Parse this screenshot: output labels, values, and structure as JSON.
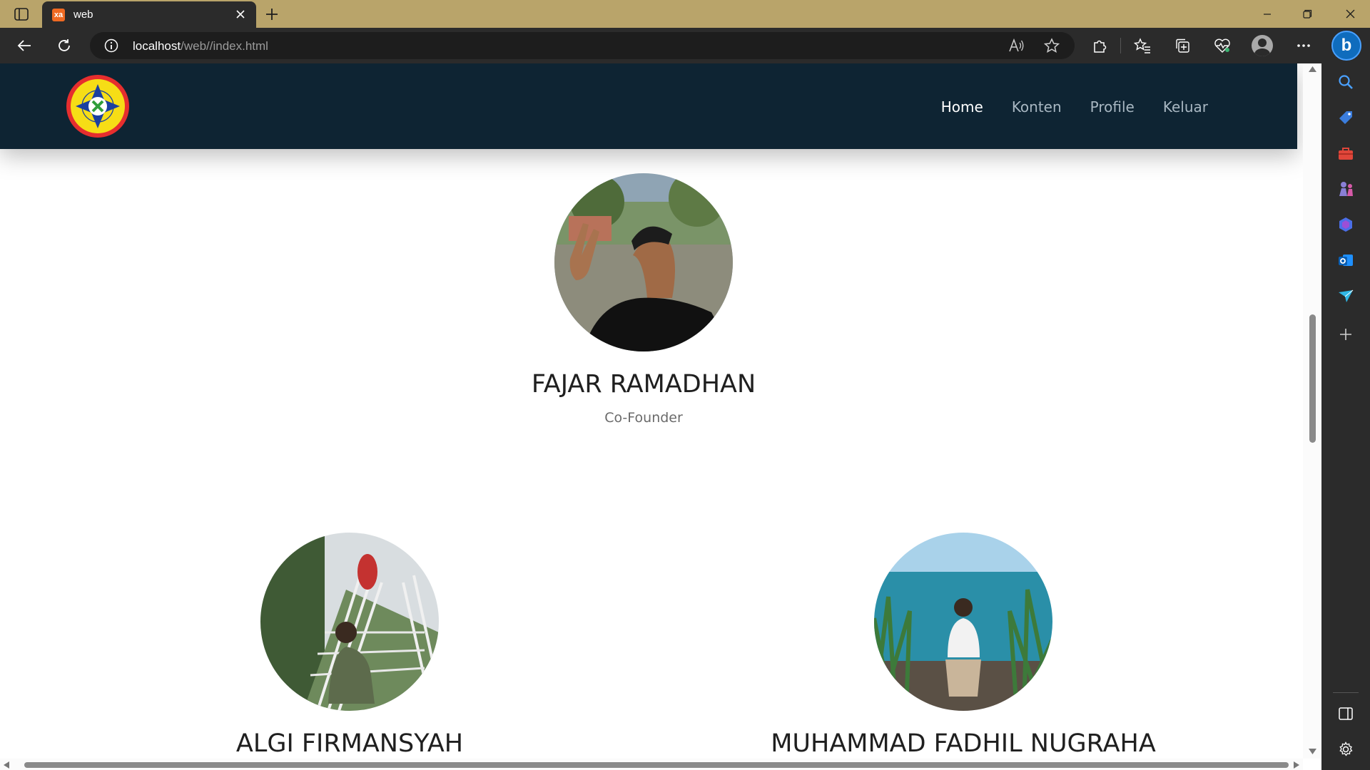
{
  "browser": {
    "tab_title": "web",
    "tab_favicon_text": "xa",
    "url_host": "localhost",
    "url_path": "/web//index.html",
    "accent_color": "#b9a46a"
  },
  "site": {
    "logo_name": "school-emblem",
    "nav": [
      {
        "label": "Home",
        "active": true
      },
      {
        "label": "Konten",
        "active": false
      },
      {
        "label": "Profile",
        "active": false
      },
      {
        "label": "Keluar",
        "active": false
      }
    ],
    "header_color": "#0e2433"
  },
  "team": [
    {
      "name": "FAJAR RAMADHAN",
      "role": "Co-Founder",
      "photo": "selfie-peace-sign"
    },
    {
      "name": "ALGI FIRMANSYAH",
      "role": "",
      "photo": "sitting-on-stairs"
    },
    {
      "name": "MUHAMMAD FADHIL NUGRAHA",
      "role": "",
      "photo": "sitting-by-sea"
    }
  ],
  "side_panel_icons": [
    "search-icon",
    "shopping-tag-icon",
    "toolbox-icon",
    "games-icon",
    "copilot-icon",
    "outlook-icon",
    "send-icon",
    "add-icon",
    "sidebar-toggle-icon",
    "settings-icon"
  ]
}
